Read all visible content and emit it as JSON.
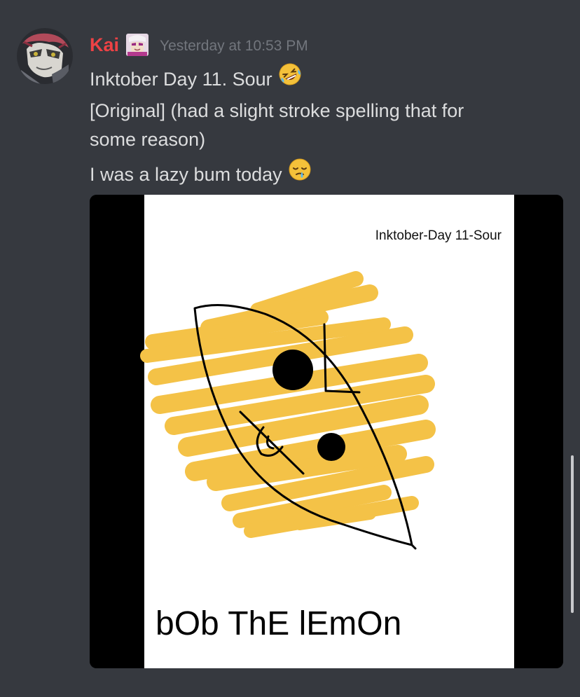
{
  "message": {
    "author": "Kai",
    "timestamp": "Yesterday at 10:53 PM",
    "author_color": "#ed4245",
    "lines": [
      "Inktober Day 11. Sour",
      "[Original] (had a slight stroke spelling that for",
      "some reason)",
      "I was a lazy bum today"
    ],
    "emojis": [
      "rolling-on-floor-laughing",
      "sleepy-face"
    ]
  },
  "attachment": {
    "caption": "Inktober-Day 11-Sour",
    "drawing_text": "bOb ThE lEmOn",
    "lemon_color": "#f4c247"
  },
  "theme": {
    "background": "#36393f",
    "text": "#dcddde",
    "muted": "#72767d"
  }
}
